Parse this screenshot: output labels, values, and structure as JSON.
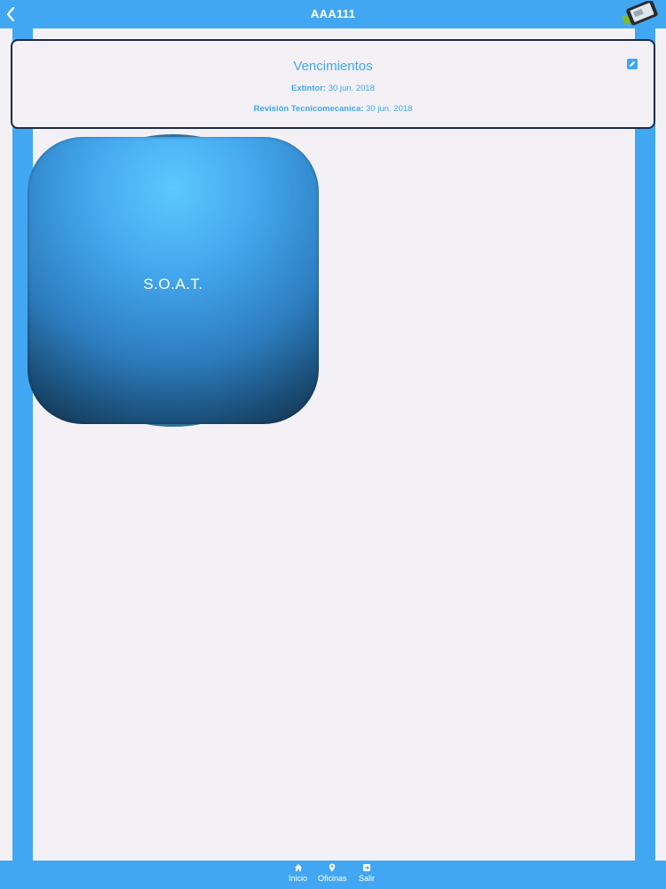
{
  "header": {
    "title": "AAA111",
    "back_icon": "chevron-left-icon",
    "logo_icon": "phone-logo-icon"
  },
  "card": {
    "title": "Vencimientos",
    "edit_icon": "pencil-icon",
    "items": [
      {
        "label": "Extintor:",
        "value": "30 jun. 2018"
      },
      {
        "label": "Revisión Tecnicomecanica:",
        "value": "30 jun. 2018"
      }
    ]
  },
  "soat": {
    "label": "S.O.A.T."
  },
  "tabs": [
    {
      "label": "Inicio",
      "icon": "home-icon"
    },
    {
      "label": "Oficinas",
      "icon": "location-pin-icon"
    },
    {
      "label": "Salir",
      "icon": "exit-icon"
    }
  ],
  "colors": {
    "accent": "#42a7f2",
    "background": "#f3f1f6",
    "card_border": "#1c2a4a"
  }
}
